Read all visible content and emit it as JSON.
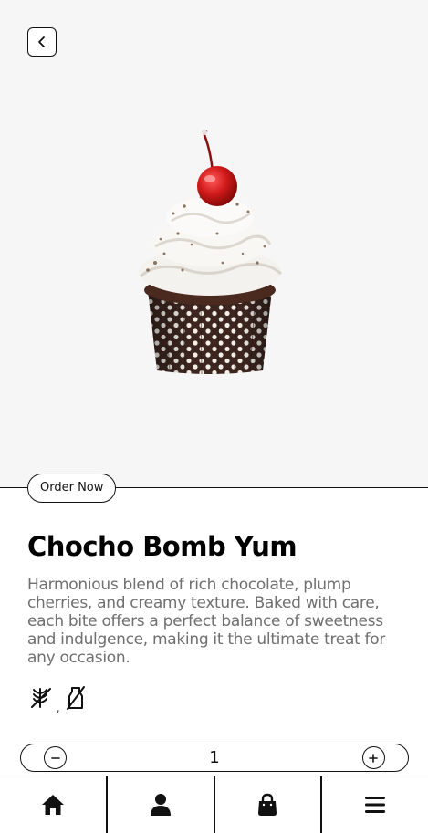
{
  "header": {
    "back_icon": "chevron-left-icon"
  },
  "hero": {
    "image": "cupcake-with-cherry"
  },
  "order_button": {
    "label": "Order Now"
  },
  "product": {
    "title": "Chocho Bomb Yum",
    "description": "Harmonious blend of rich chocolate, plump cherries, and creamy texture. Baked with care, each bite offers a perfect balance of sweetness and indulgence, making it the ultimate treat for any occasion.",
    "dietary_icons": [
      "no-gluten-icon",
      "no-dairy-icon"
    ],
    "dietary_separator": ","
  },
  "quantity": {
    "value": "1",
    "decrement_icon": "minus-icon",
    "increment_icon": "plus-icon"
  },
  "nav": {
    "items": [
      {
        "icon": "home-icon"
      },
      {
        "icon": "user-icon"
      },
      {
        "icon": "shopping-bag-icon"
      },
      {
        "icon": "menu-icon"
      }
    ]
  }
}
